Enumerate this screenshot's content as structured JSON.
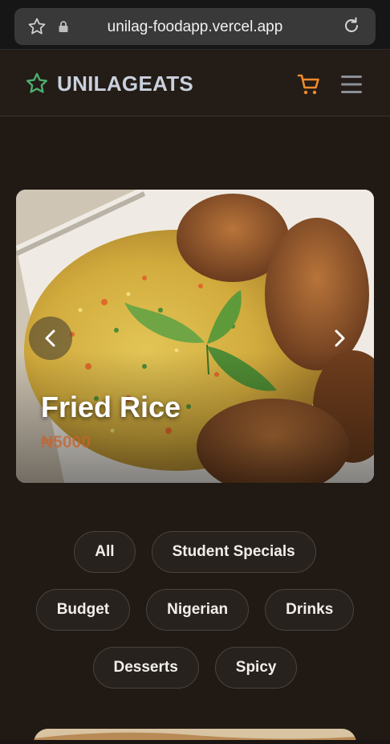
{
  "browser": {
    "url": "unilag-foodapp.vercel.app",
    "icons": [
      "star-icon",
      "lock-icon",
      "reload-icon"
    ]
  },
  "header": {
    "brand": "UNILAGEATS",
    "brand_color": "#4caf6e",
    "accent_color": "#f08a2a",
    "icons": [
      "star-icon",
      "cart-icon",
      "menu-icon"
    ]
  },
  "hero": {
    "title": "Fried Rice",
    "price": "₦5000",
    "icons": [
      "chevron-left-icon",
      "chevron-right-icon"
    ]
  },
  "categories": {
    "rows": [
      [
        "All",
        "Student Specials"
      ],
      [
        "Budget",
        "Nigerian",
        "Drinks"
      ],
      [
        "Desserts",
        "Spicy"
      ]
    ]
  }
}
